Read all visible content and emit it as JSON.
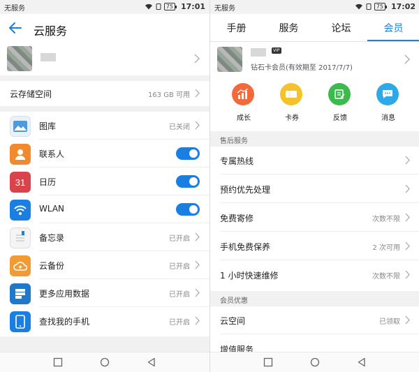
{
  "status": {
    "carrier": "无服务",
    "battery": "75",
    "time_left": "17:01",
    "time_right": "17:02"
  },
  "left": {
    "title": "云服务",
    "storage": {
      "label": "云存储空间",
      "value": "163 GB 可用"
    },
    "apps": [
      {
        "label": "图库",
        "state": "已关闭",
        "control": "chevron"
      },
      {
        "label": "联系人",
        "state": "",
        "control": "toggle"
      },
      {
        "label": "日历",
        "state": "",
        "control": "toggle",
        "icon_text": "31"
      },
      {
        "label": "WLAN",
        "state": "",
        "control": "toggle"
      },
      {
        "label": "备忘录",
        "state": "已开启",
        "control": "chevron"
      },
      {
        "label": "云备份",
        "state": "已开启",
        "control": "chevron"
      },
      {
        "label": "更多应用数据",
        "state": "已开启",
        "control": "chevron"
      },
      {
        "label": "查找我的手机",
        "state": "已开启",
        "control": "chevron"
      }
    ]
  },
  "right": {
    "tabs": [
      "手册",
      "服务",
      "论坛",
      "会员"
    ],
    "active_tab": "会员",
    "vip_badge": "VIP",
    "membership": "钻石卡会员(有效期至 2017/7/7)",
    "quick_actions": [
      {
        "label": "成长",
        "color": "#f26a3b"
      },
      {
        "label": "卡券",
        "color": "#f5c22b"
      },
      {
        "label": "反馈",
        "color": "#3dba4e"
      },
      {
        "label": "消息",
        "color": "#2ea8e6"
      }
    ],
    "sections": [
      {
        "header": "售后服务",
        "rows": [
          {
            "label": "专属热线",
            "value": ""
          },
          {
            "label": "预约优先处理",
            "value": ""
          },
          {
            "label": "免费寄修",
            "value": "次数不限"
          },
          {
            "label": "手机免费保养",
            "value": "2 次可用"
          },
          {
            "label": "1 小时快速维修",
            "value": "次数不限"
          }
        ]
      },
      {
        "header": "会员优惠",
        "rows": [
          {
            "label": "云空间",
            "value": "已领取"
          },
          {
            "label": "增值服务",
            "value": ""
          }
        ]
      }
    ]
  },
  "colors": {
    "accent": "#1a7fe0",
    "divider": "#ececec",
    "section_bg": "#f1f1f1"
  }
}
